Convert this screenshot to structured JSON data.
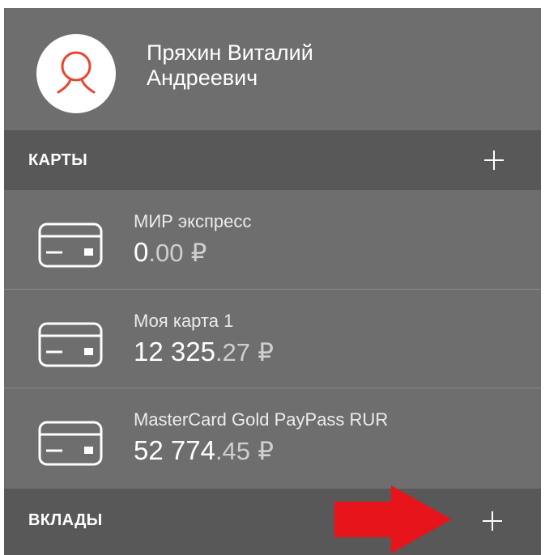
{
  "profile": {
    "name_line1": "Пряхин Виталий",
    "name_line2": "Андреевич"
  },
  "cards_section": {
    "title": "КАРТЫ",
    "add_icon": "plus-icon"
  },
  "cards": [
    {
      "name": "МИР экспресс",
      "balance_int": "0",
      "balance_frac": ".00",
      "currency": "₽"
    },
    {
      "name": "Моя карта 1",
      "balance_int": "12 325",
      "balance_frac": ".27",
      "currency": "₽"
    },
    {
      "name": "MasterCard Gold PayPass RUR",
      "balance_int": "52 774",
      "balance_frac": ".45",
      "currency": "₽"
    }
  ],
  "deposits_section": {
    "title": "ВКЛАДЫ",
    "add_icon": "plus-icon"
  },
  "colors": {
    "panel": "#6e6e6e",
    "section_header": "#585858",
    "avatar_accent": "#e8452f",
    "annotation_arrow": "#e8141c"
  }
}
